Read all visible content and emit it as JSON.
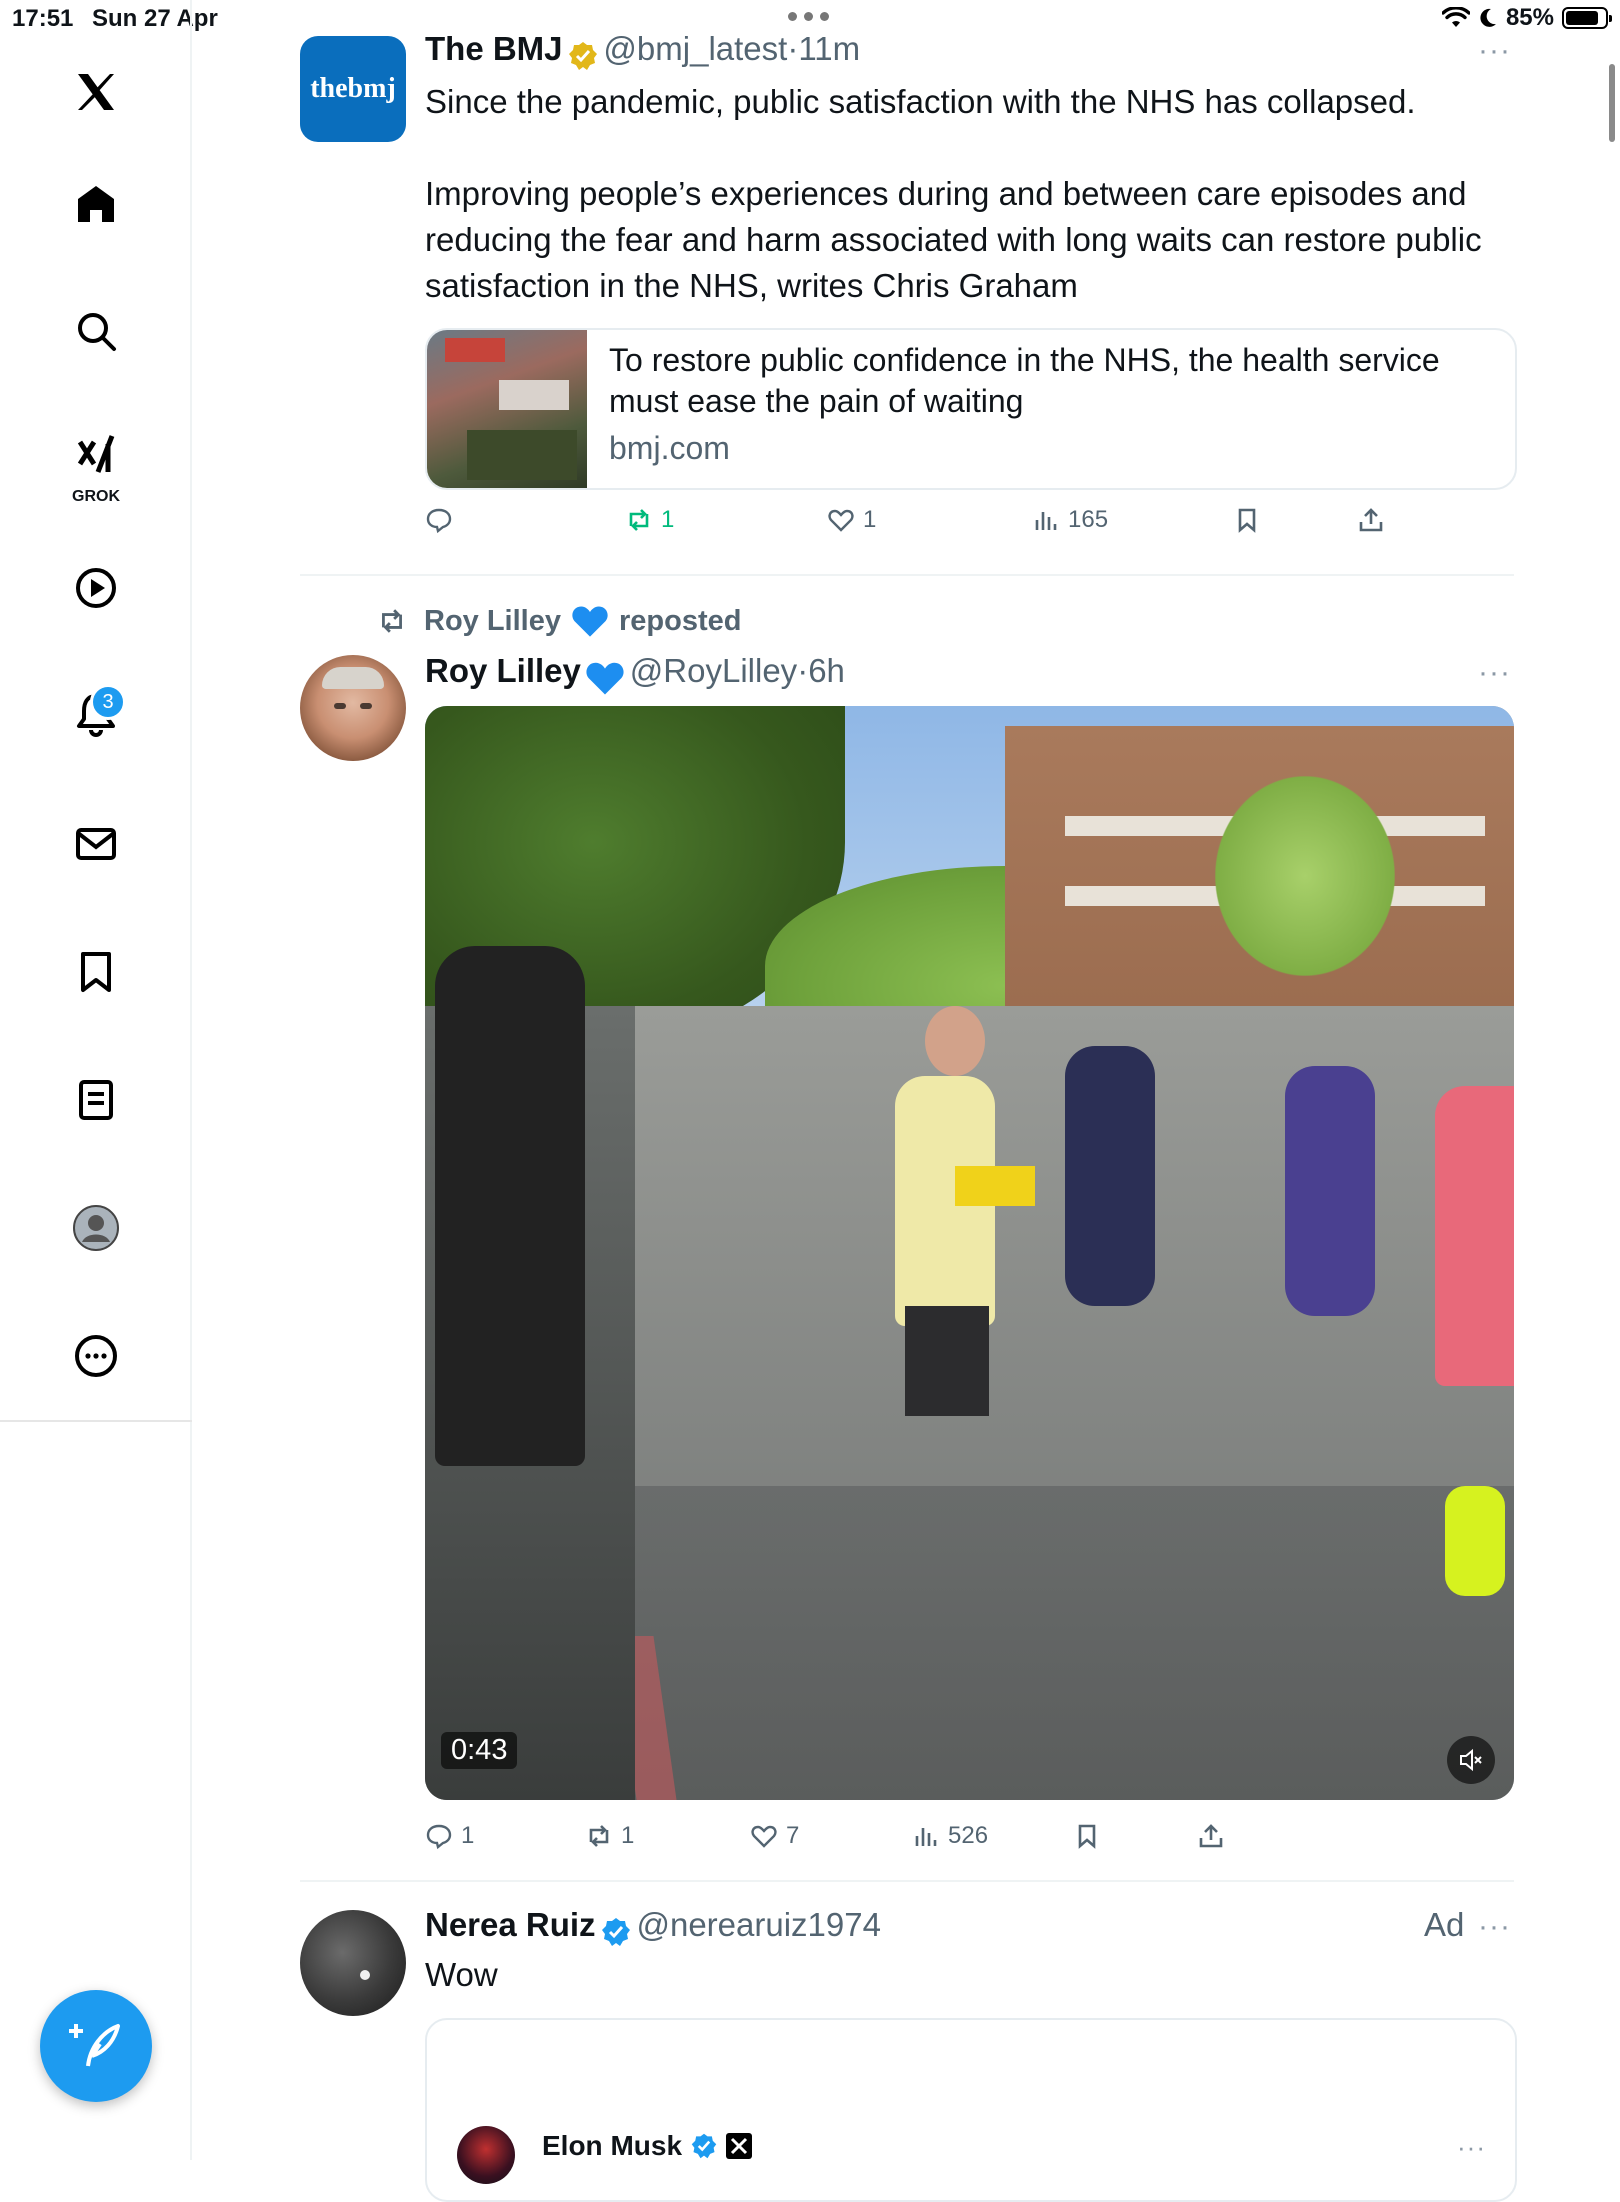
{
  "status_bar": {
    "time": "17:51",
    "date": "Sun 27 Apr",
    "battery": "85%",
    "battery_level": 0.85
  },
  "sidebar": {
    "items": [
      {
        "icon": "x-logo-icon"
      },
      {
        "icon": "home-icon"
      },
      {
        "icon": "search-icon"
      },
      {
        "icon": "grok-icon",
        "label": "GROK"
      },
      {
        "icon": "video-icon"
      },
      {
        "icon": "notifications-icon",
        "badge": "3"
      },
      {
        "icon": "messages-icon"
      },
      {
        "icon": "bookmarks-icon"
      },
      {
        "icon": "lists-icon"
      },
      {
        "icon": "profile-icon"
      },
      {
        "icon": "more-icon"
      }
    ],
    "compose_icon": "compose-icon"
  },
  "tweets": [
    {
      "avatar_text": "thebmj",
      "name": "The BMJ",
      "handle": "@bmj_latest",
      "time": "11m",
      "text_1": "Since the pandemic, public satisfaction with the NHS has collapsed.",
      "text_2": "Improving people’s experiences during and between care episodes and reducing the fear and harm associated with long waits can restore public satisfaction in the NHS, writes Chris Graham",
      "card_title": "To restore public confidence in the NHS, the health service must ease the pain of waiting",
      "card_domain": "bmj.com",
      "replies": "",
      "reposts": "1",
      "likes": "1",
      "views": "165",
      "colors": {
        "repost_active": "#00ba7c",
        "avatar_bg": "#0a6ebd"
      }
    },
    {
      "repost_by": "Roy Lilley",
      "repost_label": "reposted",
      "name": "Roy Lilley",
      "handle": "@RoyLilley",
      "time": "6h",
      "video_duration": "0:43",
      "replies": "1",
      "reposts": "1",
      "likes": "7",
      "views": "526"
    },
    {
      "name": "Nerea Ruiz",
      "handle": "@nerearuiz1974",
      "ad_label": "Ad",
      "text": "Wow",
      "quoted_name": "Elon Musk"
    }
  ],
  "colors": {
    "accent": "#1d9bf0",
    "verified_gold": "#e2b719",
    "text_secondary": "#536471"
  }
}
